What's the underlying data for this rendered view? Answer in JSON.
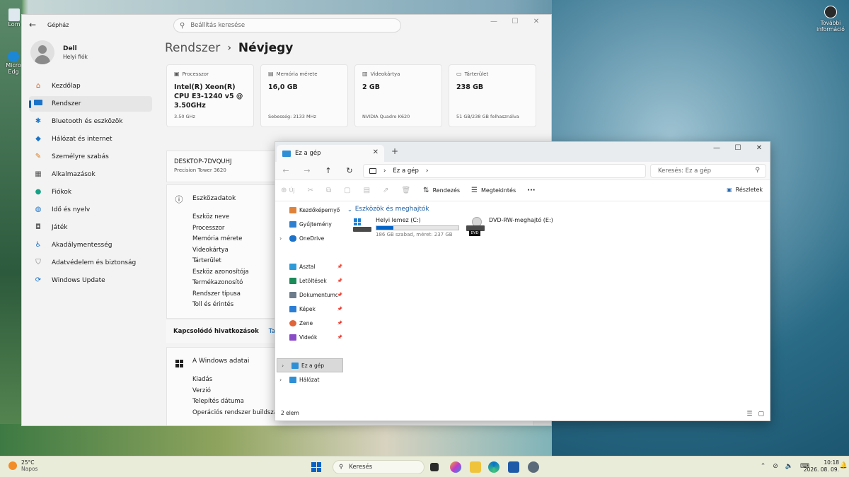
{
  "desktop": {
    "icon1": "Lom",
    "icon2": "Micro\nEdg",
    "more_info": "További információ"
  },
  "settings": {
    "app_title": "Gépház",
    "search_placeholder": "Beállítás keresése",
    "user_name": "Dell",
    "user_sub": "Helyi fiók",
    "nav": [
      {
        "label": "Kezdőlap",
        "icon": "home-icon"
      },
      {
        "label": "Rendszer",
        "icon": "system-icon"
      },
      {
        "label": "Bluetooth és eszközök",
        "icon": "bluetooth-icon"
      },
      {
        "label": "Hálózat és internet",
        "icon": "wifi-icon"
      },
      {
        "label": "Személyre szabás",
        "icon": "brush-icon"
      },
      {
        "label": "Alkalmazások",
        "icon": "apps-icon"
      },
      {
        "label": "Fiókok",
        "icon": "person-icon"
      },
      {
        "label": "Idő és nyelv",
        "icon": "globe-icon"
      },
      {
        "label": "Játék",
        "icon": "gamepad-icon"
      },
      {
        "label": "Akadálymentesség",
        "icon": "accessibility-icon"
      },
      {
        "label": "Adatvédelem és biztonság",
        "icon": "shield-icon"
      },
      {
        "label": "Windows Update",
        "icon": "update-icon"
      }
    ],
    "breadcrumb_parent": "Rendszer",
    "breadcrumb_current": "Névjegy",
    "cards": [
      {
        "label": "Processzor",
        "value": "Intel(R) Xeon(R) CPU E3-1240 v5 @ 3.50GHz",
        "sub": "3.50 GHz",
        "icon": "cpu-icon"
      },
      {
        "label": "Memória mérete",
        "value": "16,0 GB",
        "sub": "Sebesség: 2133 MHz",
        "icon": "memory-icon"
      },
      {
        "label": "Videokártya",
        "value": "2 GB",
        "sub": "NVIDIA Quadro K620",
        "icon": "gpu-icon"
      },
      {
        "label": "Tárterület",
        "value": "238 GB",
        "sub": "51 GB/238 GB felhasználva",
        "icon": "storage-icon"
      }
    ],
    "device_name": "DESKTOP-7DVQUHJ",
    "device_model": "Precision Tower 3620",
    "device_section_title": "Eszközadatok",
    "device_rows": [
      "Eszköz neve",
      "Processzor",
      "Memória mérete",
      "Videokártya",
      "Tárterület",
      "Eszköz azonosítója",
      "Termékazonosító",
      "Rendszer típusa",
      "Toll és érintés"
    ],
    "related_label": "Kapcsolódó hivatkozások",
    "related_link": "Tartomá",
    "windows_section_title": "A Windows adatai",
    "windows_rows": [
      "Kiadás",
      "Verzió",
      "Telepítés dátuma",
      "Operációs rendszer buildszáma"
    ]
  },
  "explorer": {
    "tab_title": "Ez a gép",
    "address": "Ez a gép",
    "search_placeholder": "Keresés: Ez a gép",
    "cmd_new": "Új",
    "cmd_sort": "Rendezés",
    "cmd_view": "Megtekintés",
    "cmd_more": "···",
    "cmd_details": "Részletek",
    "sidebar": [
      {
        "label": "Kezdőképernyő",
        "icon": "home-icon",
        "color": "#e0823a"
      },
      {
        "label": "Gyűjtemény",
        "icon": "gallery-icon",
        "color": "#2f7fd0"
      },
      {
        "label": "OneDrive",
        "icon": "cloud-icon",
        "color": "#1e73c8",
        "expand": true
      },
      {
        "label": "Asztal",
        "icon": "desktop-icon",
        "color": "#2e9ad8",
        "pin": true
      },
      {
        "label": "Letöltések",
        "icon": "download-icon",
        "color": "#1b8b5a",
        "pin": true
      },
      {
        "label": "Dokumentumok",
        "icon": "document-icon",
        "color": "#6d7c8c",
        "pin": true
      },
      {
        "label": "Képek",
        "icon": "pictures-icon",
        "color": "#2c7ed4",
        "pin": true
      },
      {
        "label": "Zene",
        "icon": "music-icon",
        "color": "#e0643a",
        "pin": true
      },
      {
        "label": "Videók",
        "icon": "video-icon",
        "color": "#8a4bc7",
        "pin": true
      },
      {
        "label": "Ez a gép",
        "icon": "computer-icon",
        "color": "#2f8fd6",
        "expand": true,
        "selected": true
      },
      {
        "label": "Hálózat",
        "icon": "network-icon",
        "color": "#2f8fd6",
        "expand": true
      }
    ],
    "group_title": "Eszközök és meghajtók",
    "drive_c": {
      "name": "Helyi lemez (C:)",
      "info": "186 GB szabad, méret: 237 GB",
      "used_fraction": 0.21
    },
    "drive_e": {
      "name": "DVD-RW-meghajtó (E:)",
      "badge": "DVD"
    },
    "status": "2 elem"
  },
  "taskbar": {
    "temp": "25°C",
    "weather": "Napos",
    "search": "Keresés",
    "time": "10:18",
    "date": "2026. 08. 09."
  }
}
